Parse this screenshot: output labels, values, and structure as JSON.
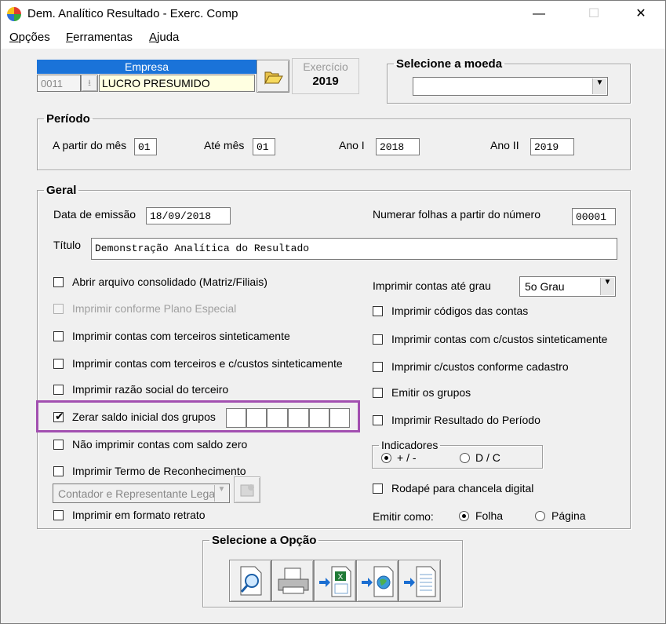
{
  "window": {
    "title": "Dem. Analítico Resultado - Exerc. Comp",
    "controls": {
      "minimize": "—",
      "maximize": "☐",
      "close": "✕"
    }
  },
  "menu": {
    "items": [
      {
        "label": "Opções",
        "underline_char": "O"
      },
      {
        "label": "Ferramentas",
        "underline_char": "F"
      },
      {
        "label": "Ajuda",
        "underline_char": "A"
      }
    ]
  },
  "empresa": {
    "header": "Empresa",
    "code": "0011",
    "name": "LUCRO PRESUMIDO",
    "header_color": "#1a73d9"
  },
  "exercicio": {
    "label": "Exercício",
    "year": "2019"
  },
  "moeda": {
    "legend": "Selecione a moeda",
    "value": ""
  },
  "periodo": {
    "legend": "Período",
    "from_month_label": "A partir do mês",
    "from_month": "01",
    "to_month_label": "Até mês",
    "to_month": "01",
    "year1_label": "Ano I",
    "year1": "2018",
    "year2_label": "Ano II",
    "year2": "2019"
  },
  "geral": {
    "legend": "Geral",
    "emission_label": "Data de emissão",
    "emission_date": "18/09/2018",
    "page_number_label": "Numerar folhas a partir do número",
    "page_number": "00001",
    "title_label": "Título",
    "title_value": "Demonstração Analítica do Resultado",
    "left_options": [
      {
        "label": "Abrir arquivo consolidado (Matriz/Filiais)",
        "checked": false,
        "disabled": false
      },
      {
        "label": "Imprimir conforme Plano Especial",
        "checked": false,
        "disabled": true
      },
      {
        "label": "Imprimir contas com terceiros sinteticamente",
        "checked": false,
        "disabled": false
      },
      {
        "label": "Imprimir contas com terceiros e c/custos sinteticamente",
        "checked": false,
        "disabled": false
      },
      {
        "label": "Imprimir razão social do terceiro",
        "checked": false,
        "disabled": false
      },
      {
        "label": "Zerar saldo inicial dos grupos",
        "checked": true,
        "disabled": false
      },
      {
        "label": "Não imprimir contas com saldo zero",
        "checked": false,
        "disabled": false
      },
      {
        "label": "Imprimir Termo de Reconhecimento",
        "checked": false,
        "disabled": false
      }
    ],
    "reconhecimento_combo": "Contador e Representante Legal",
    "retrato_option": {
      "label": "Imprimir em formato retrato",
      "checked": false
    },
    "grade_label": "Imprimir contas até grau",
    "grade_value": "5o Grau",
    "right_options": [
      {
        "label": "Imprimir códigos das contas",
        "checked": false
      },
      {
        "label": "Imprimir contas com c/custos sinteticamente",
        "checked": false
      },
      {
        "label": "Imprimir c/custos conforme cadastro",
        "checked": false
      },
      {
        "label": "Emitir os grupos",
        "checked": false
      },
      {
        "label": "Imprimir Resultado do Período",
        "checked": false
      }
    ],
    "indicadores": {
      "legend": "Indicadores",
      "options": [
        {
          "label": "+ / -",
          "selected": true
        },
        {
          "label": "D / C",
          "selected": false
        }
      ]
    },
    "rodape": {
      "label": "Rodapé para chancela digital",
      "checked": false
    },
    "emitir_como": {
      "label": "Emitir como:",
      "options": [
        {
          "label": "Folha",
          "selected": true
        },
        {
          "label": "Página",
          "selected": false
        }
      ]
    },
    "highlight_color": "#a24fb0"
  },
  "opcoes": {
    "legend": "Selecione a Opção",
    "buttons": [
      "preview-icon",
      "printer-icon",
      "excel-export-icon",
      "web-export-icon",
      "document-export-icon"
    ]
  }
}
